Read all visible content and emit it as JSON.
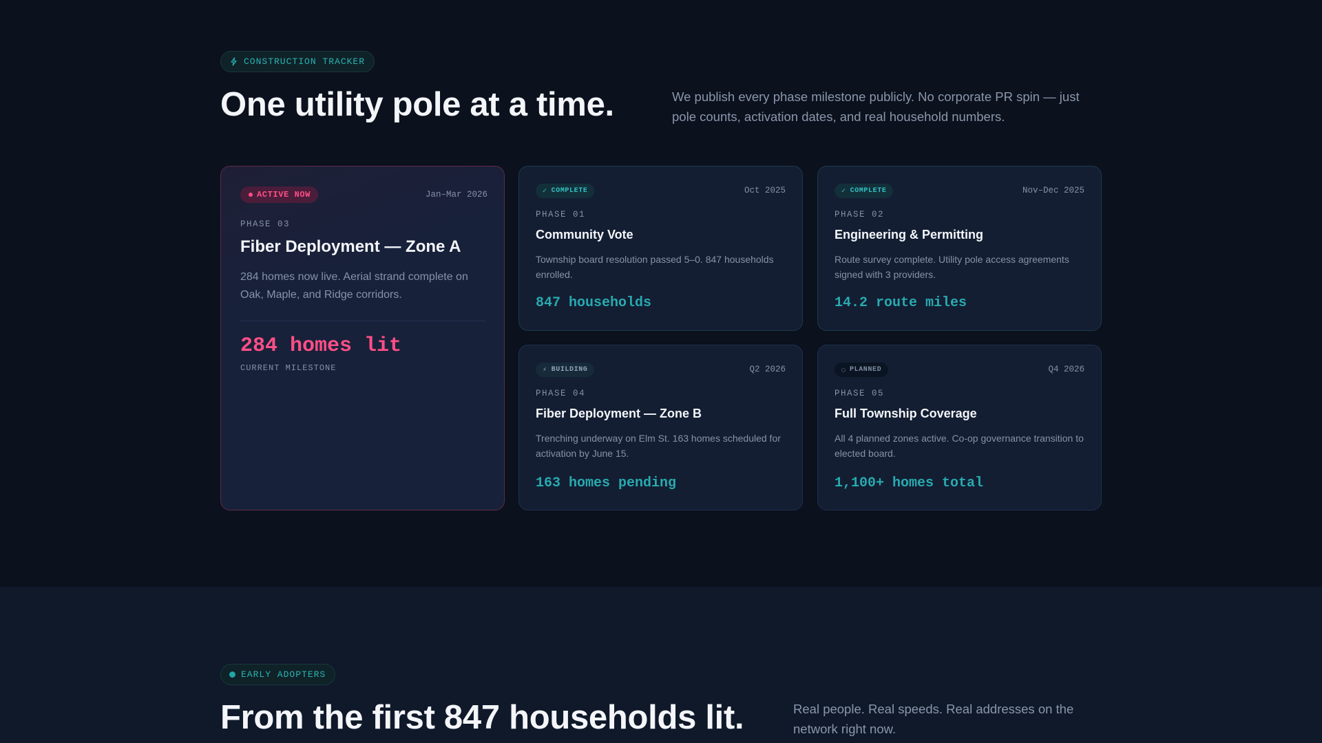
{
  "tracker": {
    "badge_label": "CONSTRUCTION TRACKER",
    "heading": "One utility pole at a time.",
    "description": "We publish every phase milestone publicly. No corporate PR spin — just pole counts, activation dates, and real household numbers."
  },
  "featured_phase": {
    "status": "ACTIVE NOW",
    "date": "Jan–Mar 2026",
    "phase": "PHASE 03",
    "title": "Fiber Deployment — Zone A",
    "description": "284 homes now live. Aerial strand complete on Oak, Maple, and Ridge corridors.",
    "metric": "284 homes lit",
    "metric_caption": "CURRENT MILESTONE"
  },
  "phases": [
    {
      "status": "COMPLETE",
      "status_icon": "check-icon",
      "date": "Oct 2025",
      "phase": "PHASE 01",
      "title": "Community Vote",
      "description": "Township board resolution passed 5–0. 847 households enrolled.",
      "metric": "847 households"
    },
    {
      "status": "COMPLETE",
      "status_icon": "check-icon",
      "date": "Nov–Dec 2025",
      "phase": "PHASE 02",
      "title": "Engineering & Permitting",
      "description": "Route survey complete. Utility pole access agreements signed with 3 providers.",
      "metric": "14.2 route miles"
    },
    {
      "status": "BUILDING",
      "status_icon": "lightning-icon",
      "date": "Q2 2026",
      "phase": "PHASE 04",
      "title": "Fiber Deployment — Zone B",
      "description": "Trenching underway on Elm St. 163 homes scheduled for activation by June 15.",
      "metric": "163 homes pending"
    },
    {
      "status": "PLANNED",
      "status_icon": "circle-outline-icon",
      "date": "Q4 2026",
      "phase": "PHASE 05",
      "title": "Full Township Coverage",
      "description": "All 4 planned zones active. Co-op governance transition to elected board.",
      "metric": "1,100+ homes total"
    }
  ],
  "adopters": {
    "badge_label": "EARLY ADOPTERS",
    "heading": "From the first 847 households lit.",
    "description": "Real people. Real speeds. Real addresses on the network right now."
  },
  "colors": {
    "background": "#0b111d",
    "accent_teal": "#28aab0",
    "accent_pink": "#ff4f86",
    "card": "#131e32"
  }
}
